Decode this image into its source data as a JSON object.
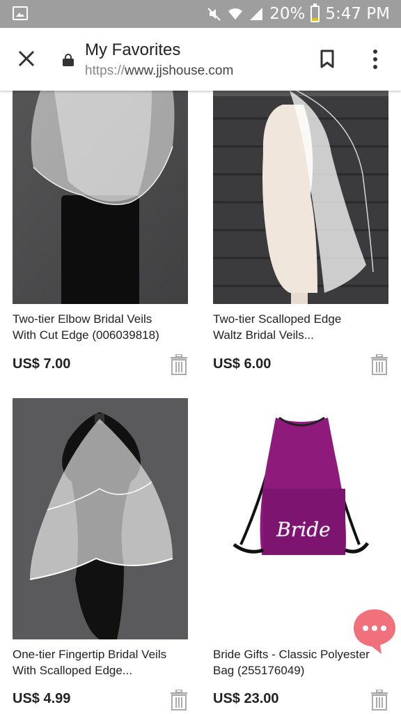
{
  "status_bar": {
    "battery": "20%",
    "time": "5:47 PM",
    "icons": [
      "image-icon",
      "mute-icon",
      "wifi-icon",
      "signal-icon",
      "battery-icon"
    ]
  },
  "app_bar": {
    "title": "My Favorites",
    "url_scheme": "https://",
    "url_host": "www.jjshouse.com"
  },
  "products": [
    {
      "name_line1": "Two-tier Elbow Bridal Veils",
      "name_line2": "With Cut Edge (006039818)",
      "price": "US$ 7.00"
    },
    {
      "name_line1": "Two-tier Scalloped Edge",
      "name_line2": "Waltz Bridal Veils...",
      "price": "US$ 6.00"
    },
    {
      "name_line1": "One-tier Fingertip Bridal Veils",
      "name_line2": "With Scalloped Edge...",
      "price": "US$ 4.99"
    },
    {
      "name_line1": "Bride Gifts - Classic Polyester",
      "name_line2": "Bag (255176049)",
      "price": "US$ 23.00",
      "bag_text": "Bride"
    }
  ],
  "colors": {
    "chat_accent": "#f0707c",
    "bag_purple": "#8e1a7c"
  }
}
